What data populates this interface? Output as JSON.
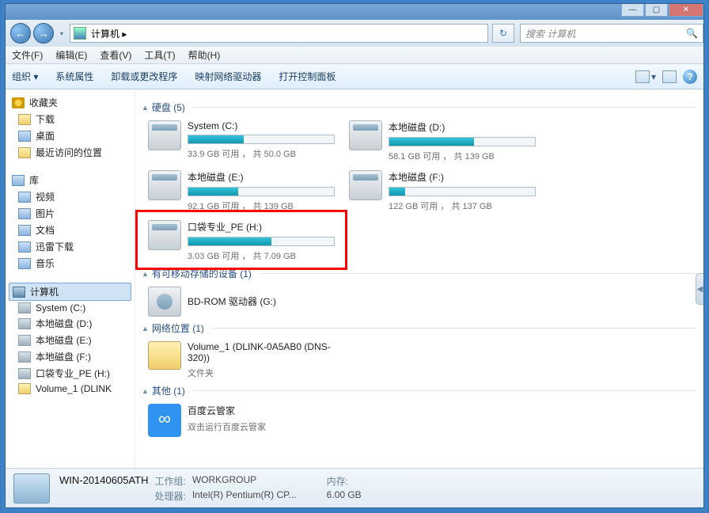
{
  "titlebar": {
    "min": "—",
    "max": "▢",
    "close": "✕"
  },
  "nav": {
    "back": "←",
    "fwd": "→",
    "drop": "▾",
    "path": "计算机 ▸",
    "refresh": "↻",
    "search_placeholder": "搜索 计算机",
    "search_icon": "🔍"
  },
  "menu": {
    "file": "文件(F)",
    "edit": "编辑(E)",
    "view": "查看(V)",
    "tools": "工具(T)",
    "help": "帮助(H)"
  },
  "toolbar": {
    "org": "组织 ▾",
    "sysprop": "系统属性",
    "uninstall": "卸载或更改程序",
    "mapnet": "映射网络驱动器",
    "ctrl": "打开控制面板",
    "view_drop": "▾",
    "help": "?"
  },
  "tree": {
    "fav": {
      "head": "收藏夹",
      "items": [
        "下载",
        "桌面",
        "最近访问的位置"
      ]
    },
    "lib": {
      "head": "库",
      "items": [
        "视频",
        "图片",
        "文档",
        "迅雷下载",
        "音乐"
      ]
    },
    "comp": {
      "head": "计算机",
      "items": [
        "System (C:)",
        "本地磁盘 (D:)",
        "本地磁盘 (E:)",
        "本地磁盘 (F:)",
        "口袋专业_PE (H:)",
        "Volume_1 (DLINK"
      ]
    }
  },
  "groups": {
    "hdd": "硬盘 (5)",
    "removable": "有可移动存储的设备 (1)",
    "network": "网络位置 (1)",
    "other": "其他 (1)"
  },
  "drives": [
    {
      "name": "System (C:)",
      "free": "33.9 GB 可用 ， 共 50.0 GB",
      "pct": 38
    },
    {
      "name": "本地磁盘 (D:)",
      "free": "58.1 GB 可用 ， 共 139 GB",
      "pct": 58
    },
    {
      "name": "本地磁盘 (E:)",
      "free": "92.1 GB 可用 ， 共 139 GB",
      "pct": 34
    },
    {
      "name": "本地磁盘 (F:)",
      "free": "122 GB 可用 ， 共 137 GB",
      "pct": 11
    },
    {
      "name": "口袋专业_PE (H:)",
      "free": "3.03 GB 可用 ， 共 7.09 GB",
      "pct": 57
    }
  ],
  "optical": {
    "name": "BD-ROM 驱动器 (G:)"
  },
  "netloc": {
    "name": "Volume_1 (DLINK-0A5AB0 (DNS-320))",
    "type": "文件夹"
  },
  "other": {
    "name": "百度云管家",
    "desc": "双击运行百度云管家"
  },
  "status": {
    "name": "WIN-20140605ATH",
    "wg_label": "工作组:",
    "wg": "WORKGROUP",
    "mem_label": "内存:",
    "mem": "6.00 GB",
    "cpu_label": "处理器:",
    "cpu": "Intel(R) Pentium(R) CP..."
  }
}
